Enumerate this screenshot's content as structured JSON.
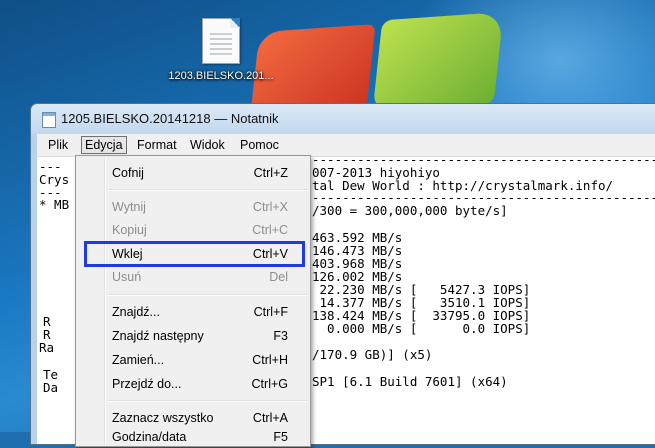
{
  "desktop": {
    "icon_label": "1203.BIELSKO.201..."
  },
  "window": {
    "title": "1205.BIELSKO.20141218 — Notatnik"
  },
  "menubar": [
    "Plik",
    "Edycja",
    "Format",
    "Widok",
    "Pomoc"
  ],
  "edit_menu": {
    "items": [
      {
        "label": "Cofnij",
        "shortcut": "Ctrl+Z",
        "enabled": true
      },
      {
        "label": "Wytnij",
        "shortcut": "Ctrl+X",
        "enabled": false
      },
      {
        "label": "Kopiuj",
        "shortcut": "Ctrl+C",
        "enabled": false
      },
      {
        "label": "Wklej",
        "shortcut": "Ctrl+V",
        "enabled": true,
        "highlighted": true
      },
      {
        "label": "Usuń",
        "shortcut": "Del",
        "enabled": false
      },
      {
        "label": "Znajdź...",
        "shortcut": "Ctrl+F",
        "enabled": true
      },
      {
        "label": "Znajdź następny",
        "shortcut": "F3",
        "enabled": true
      },
      {
        "label": "Zamień...",
        "shortcut": "Ctrl+H",
        "enabled": true
      },
      {
        "label": "Przejdź do...",
        "shortcut": "Ctrl+G",
        "enabled": true
      },
      {
        "label": "Zaznacz wszystko",
        "shortcut": "Ctrl+A",
        "enabled": true
      },
      {
        "label": "Godzina/data",
        "shortcut": "F5",
        "enabled": true
      }
    ],
    "highlight_color": "#1f3ae0"
  },
  "editor": {
    "lines": [
      "---",
      "Crys",
      "---",
      "* MB",
      "",
      "",
      "",
      "",
      "",
      "",
      "R",
      "R",
      "Ra",
      "",
      "Te",
      "Da"
    ],
    "right_lines": [
      "-----------------------------------------------",
      "007-2013 hiyohiyo",
      "tal Dew World : http://crystalmark.info/",
      "-----------------------------------------------",
      "/300 = 300,000,000 byte/s]",
      "",
      "463.592 MB/s",
      "146.473 MB/s",
      "403.968 MB/s",
      "126.002 MB/s",
      " 22.230 MB/s [   5427.3 IOPS]",
      " 14.377 MB/s [   3510.1 IOPS]",
      "138.424 MB/s [  33795.0 IOPS]",
      "  0.000 MB/s [      0.0 IOPS]",
      "",
      "/170.9 GB)] (x5)",
      "",
      "SP1 [6.1 Build 7601] (x64)"
    ]
  }
}
